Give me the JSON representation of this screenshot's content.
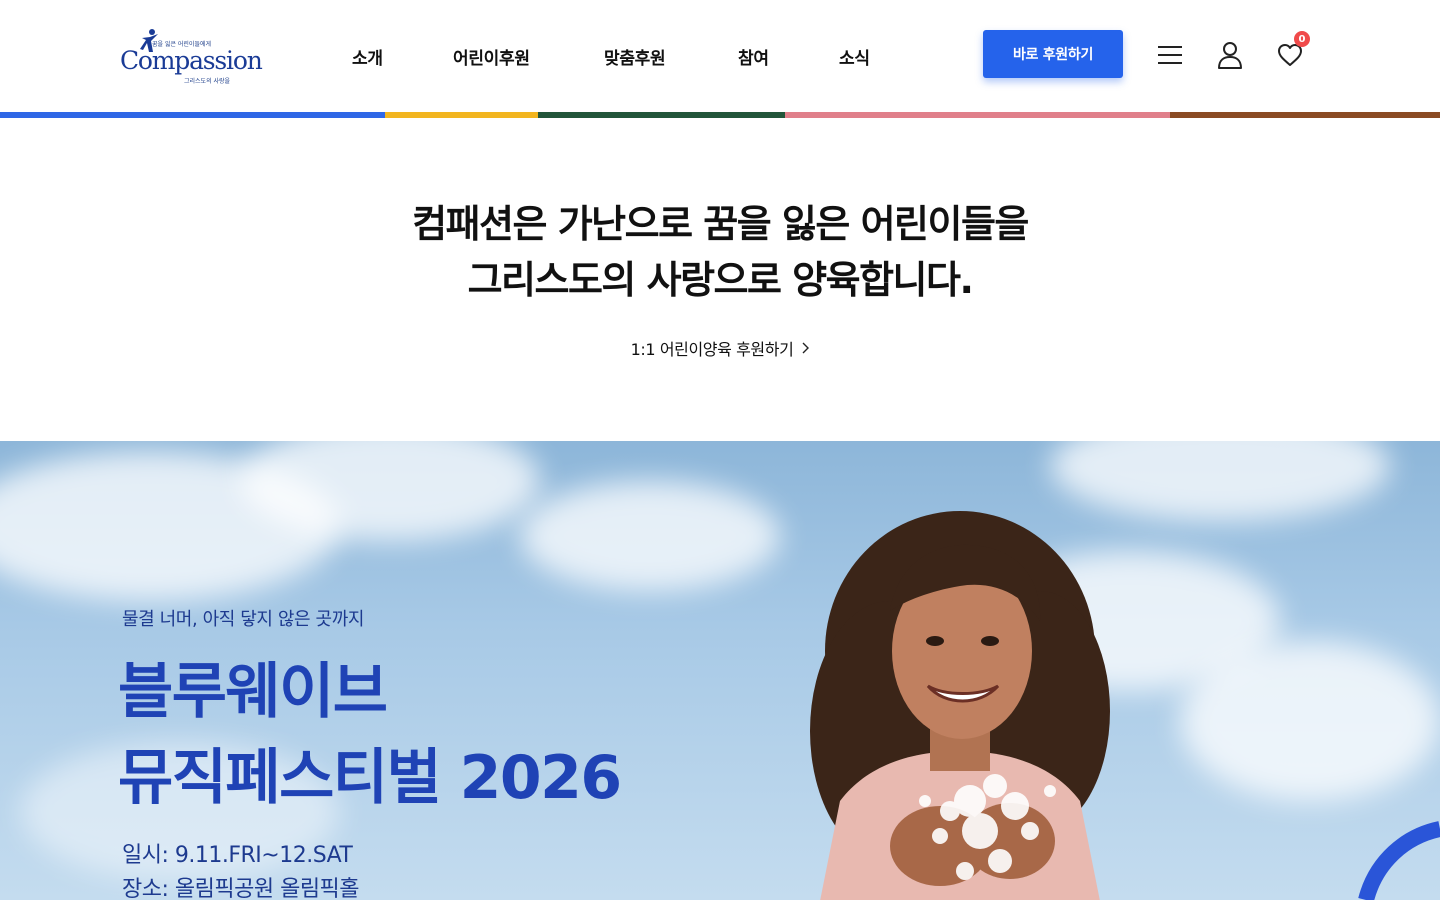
{
  "header": {
    "logo": {
      "tagline_top": "꿈을 잃은 어린이들에게",
      "wordmark": "Compassion",
      "tagline_bottom": "그리스도의 사랑을"
    },
    "nav": [
      {
        "label": "소개"
      },
      {
        "label": "어린이후원"
      },
      {
        "label": "맞춤후원"
      },
      {
        "label": "참여"
      },
      {
        "label": "소식"
      }
    ],
    "cta_label": "바로 후원하기",
    "icons": [
      "menu-icon",
      "user-icon",
      "heart-icon"
    ],
    "wishlist_count": "0"
  },
  "color_bar": [
    "#2f67e6",
    "#f2b51f",
    "#22553a",
    "#e07f8a",
    "#8a4b23"
  ],
  "intro": {
    "headline_line1": "컴패션은 가난으로 꿈을 잃은 어린이들을",
    "headline_line2": "그리스도의 사랑으로 양육합니다.",
    "link_label": "1:1 어린이양육 후원하기"
  },
  "hero": {
    "subtitle": "물결 너머, 아직 닿지 않은 곳까지",
    "title_line1": "블루웨이브",
    "title_line2": "뮤직페스티벌 2026",
    "date": "일시: 9.11.FRI~12.SAT",
    "venue": "장소: 올림픽공원 올림픽홀"
  },
  "colors": {
    "brand_blue": "#2563eb",
    "hero_text": "#1f43b5",
    "badge": "#f04a4a"
  }
}
